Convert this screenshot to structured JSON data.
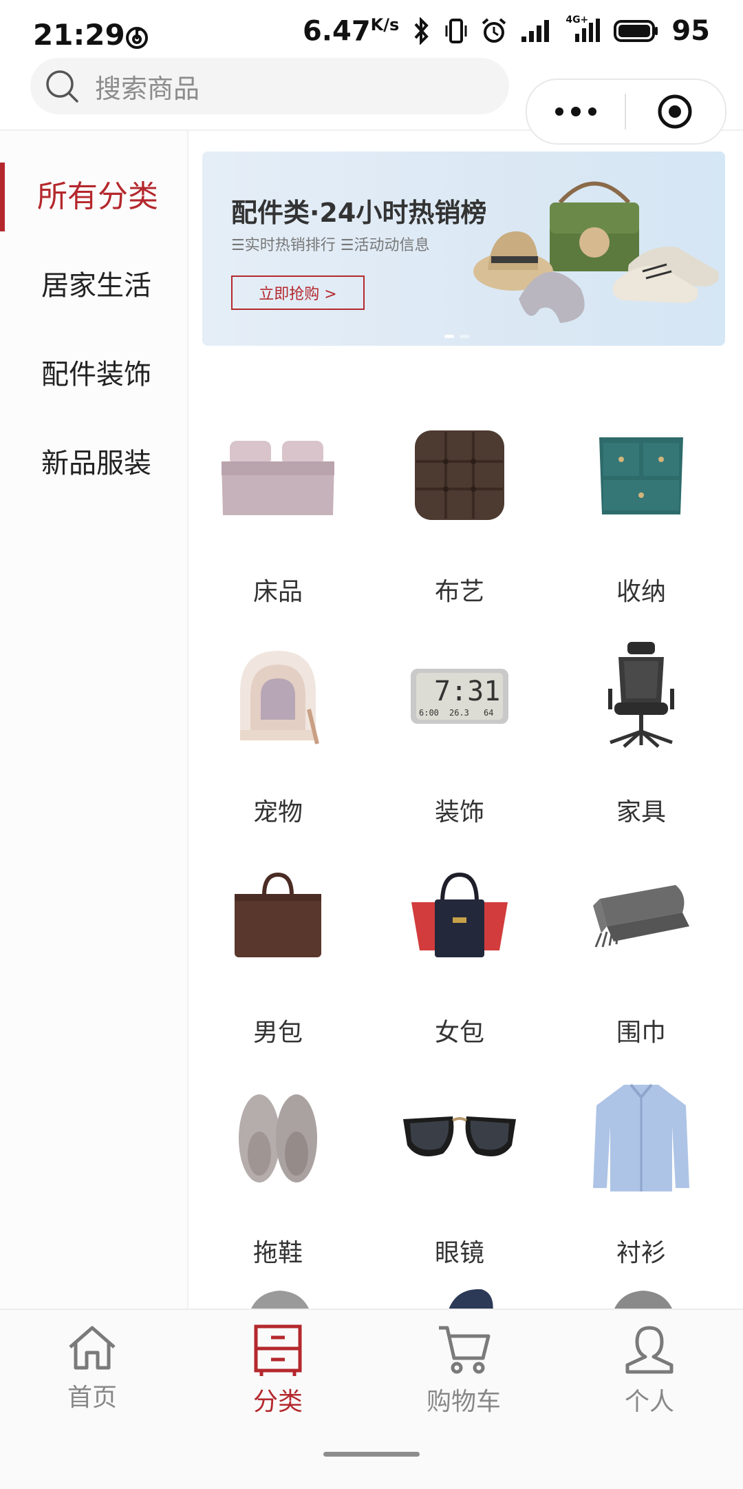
{
  "status_bar": {
    "time": "21:29",
    "speed": "6.47",
    "speed_unit": "K/s",
    "network": "4G+",
    "battery": "95"
  },
  "search": {
    "placeholder": "搜索商品"
  },
  "sidebar": {
    "items": [
      {
        "label": "所有分类",
        "active": true
      },
      {
        "label": "居家生活",
        "active": false
      },
      {
        "label": "配件装饰",
        "active": false
      },
      {
        "label": "新品服装",
        "active": false
      }
    ]
  },
  "banner": {
    "title": "配件类·24小时热销榜",
    "subtitle": "☰实时热销排行   ☰活动动信息",
    "button_label": "立即抢购 >",
    "slide_count": 2,
    "active_slide": 0
  },
  "categories": [
    {
      "label": "床品",
      "icon": "bed-icon"
    },
    {
      "label": "布艺",
      "icon": "cushion-icon"
    },
    {
      "label": "收纳",
      "icon": "drawer-cabinet-icon"
    },
    {
      "label": "宠物",
      "icon": "pet-litter-box-icon"
    },
    {
      "label": "装饰",
      "icon": "digital-clock-icon"
    },
    {
      "label": "家具",
      "icon": "office-chair-icon"
    },
    {
      "label": "男包",
      "icon": "briefcase-icon"
    },
    {
      "label": "女包",
      "icon": "handbag-icon"
    },
    {
      "label": "围巾",
      "icon": "scarf-icon"
    },
    {
      "label": "拖鞋",
      "icon": "slippers-icon"
    },
    {
      "label": "眼镜",
      "icon": "sunglasses-icon"
    },
    {
      "label": "衬衫",
      "icon": "shirt-icon"
    }
  ],
  "clock_display": {
    "time": "7:31",
    "date": "6:00",
    "temp": "26.3",
    "hum": "64"
  },
  "tabbar": {
    "tabs": [
      {
        "label": "首页",
        "icon": "home-icon",
        "active": false
      },
      {
        "label": "分类",
        "icon": "category-icon",
        "active": true
      },
      {
        "label": "购物车",
        "icon": "cart-icon",
        "active": false
      },
      {
        "label": "个人",
        "icon": "person-icon",
        "active": false
      }
    ]
  },
  "colors": {
    "accent": "#b4282d",
    "sidebar_bg": "#fcfcfc",
    "banner_bg": "#dbe8f4"
  }
}
